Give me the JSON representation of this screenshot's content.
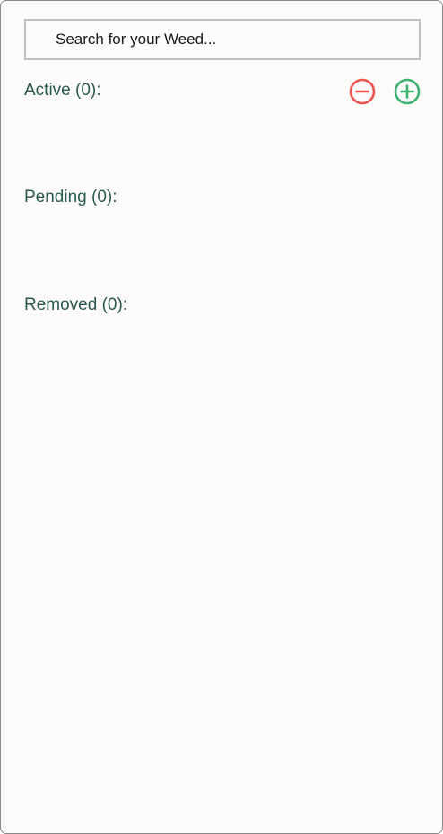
{
  "search": {
    "placeholder": "Search for your Weed..."
  },
  "sections": {
    "active_label": "Active (0):",
    "pending_label": "Pending (0):",
    "removed_label": "Removed (0):"
  },
  "actions": {
    "remove_icon": "minus-circle-icon",
    "add_icon": "plus-circle-icon"
  },
  "colors": {
    "label": "#2b5a52",
    "remove": "#ef5350",
    "add": "#3cb371",
    "background": "#fcfbf9"
  }
}
